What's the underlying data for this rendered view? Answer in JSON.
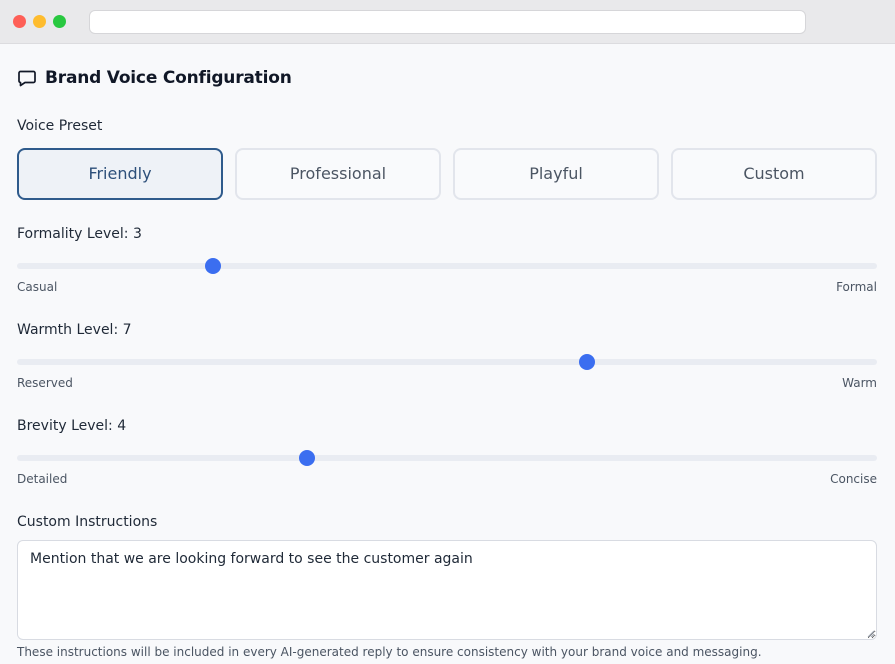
{
  "window": {
    "url": ""
  },
  "page": {
    "title": "Brand Voice Configuration",
    "title_icon": "chat-bubble-icon"
  },
  "voice_preset": {
    "label": "Voice Preset",
    "options": [
      "Friendly",
      "Professional",
      "Playful",
      "Custom"
    ],
    "selected": "Friendly"
  },
  "sliders": [
    {
      "label": "Formality Level: 3",
      "value": 3,
      "min": 1,
      "max": 10,
      "min_label": "Casual",
      "max_label": "Formal"
    },
    {
      "label": "Warmth Level: 7",
      "value": 7,
      "min": 1,
      "max": 10,
      "min_label": "Reserved",
      "max_label": "Warm"
    },
    {
      "label": "Brevity Level: 4",
      "value": 4,
      "min": 1,
      "max": 10,
      "min_label": "Detailed",
      "max_label": "Concise"
    }
  ],
  "custom_instructions": {
    "label": "Custom Instructions",
    "value": "Mention that we are looking forward to see the customer again",
    "helper": "These instructions will be included in every AI-generated reply to ensure consistency with your brand voice and messaging."
  },
  "colors": {
    "accent": "#3b6ef0",
    "selected_border": "#2f5b8c",
    "selected_bg": "#eef2f7",
    "track": "#e9ecf2"
  }
}
